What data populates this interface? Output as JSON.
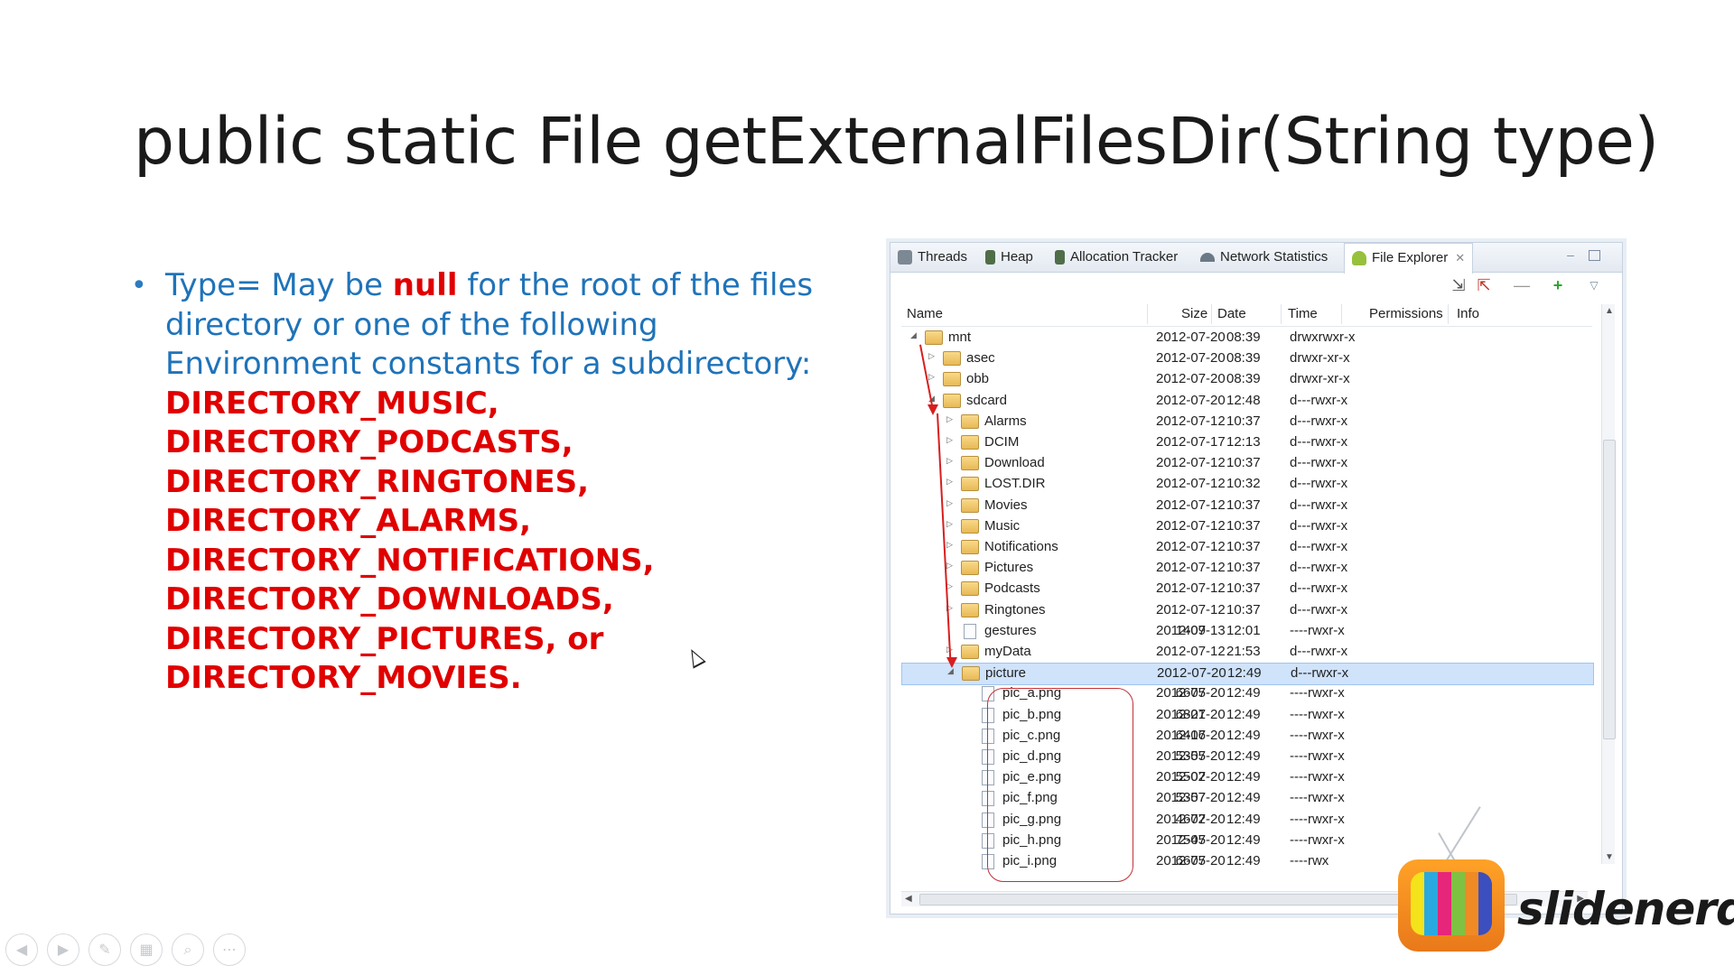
{
  "slide": {
    "title": "public static File getExternalFilesDir(String type)",
    "bullet_lead": "Type= May be ",
    "bullet_null": "null",
    "bullet_rest": " for the root of the files directory or one of the following Environment constants for a subdirectory:",
    "constants": [
      "DIRECTORY_MUSIC,",
      "DIRECTORY_PODCASTS,",
      "DIRECTORY_RINGTONES,",
      "DIRECTORY_ALARMS,",
      "DIRECTORY_NOTIFICATIONS,",
      "DIRECTORY_DOWNLOADS,",
      "DIRECTORY_PICTURES, or",
      "DIRECTORY_MOVIES."
    ],
    "accent_blue": "#1f73b9",
    "accent_red": "#e00000"
  },
  "ddms": {
    "tabs": [
      {
        "label": "Threads",
        "icon": "threads-icon"
      },
      {
        "label": "Heap",
        "icon": "heap-icon"
      },
      {
        "label": "Allocation Tracker",
        "icon": "allocation-tracker-icon"
      },
      {
        "label": "Network Statistics",
        "icon": "network-statistics-icon"
      },
      {
        "label": "File Explorer",
        "icon": "android-icon"
      }
    ],
    "toolbar": [
      "pull-file-icon",
      "push-file-icon",
      "delete-icon",
      "new-folder-icon",
      "view-menu-icon"
    ],
    "columns": {
      "name": "Name",
      "size": "Size",
      "date": "Date",
      "time": "Time",
      "permissions": "Permissions",
      "info": "Info"
    },
    "rows": [
      {
        "name": "mnt",
        "size": "",
        "date": "2012-07-20",
        "time": "08:39",
        "perm": "drwxrwxr-x"
      },
      {
        "name": "asec",
        "size": "",
        "date": "2012-07-20",
        "time": "08:39",
        "perm": "drwxr-xr-x"
      },
      {
        "name": "obb",
        "size": "",
        "date": "2012-07-20",
        "time": "08:39",
        "perm": "drwxr-xr-x"
      },
      {
        "name": "sdcard",
        "size": "",
        "date": "2012-07-20",
        "time": "12:48",
        "perm": "d---rwxr-x"
      },
      {
        "name": "Alarms",
        "size": "",
        "date": "2012-07-12",
        "time": "10:37",
        "perm": "d---rwxr-x"
      },
      {
        "name": "DCIM",
        "size": "",
        "date": "2012-07-17",
        "time": "12:13",
        "perm": "d---rwxr-x"
      },
      {
        "name": "Download",
        "size": "",
        "date": "2012-07-12",
        "time": "10:37",
        "perm": "d---rwxr-x"
      },
      {
        "name": "LOST.DIR",
        "size": "",
        "date": "2012-07-12",
        "time": "10:32",
        "perm": "d---rwxr-x"
      },
      {
        "name": "Movies",
        "size": "",
        "date": "2012-07-12",
        "time": "10:37",
        "perm": "d---rwxr-x"
      },
      {
        "name": "Music",
        "size": "",
        "date": "2012-07-12",
        "time": "10:37",
        "perm": "d---rwxr-x"
      },
      {
        "name": "Notifications",
        "size": "",
        "date": "2012-07-12",
        "time": "10:37",
        "perm": "d---rwxr-x"
      },
      {
        "name": "Pictures",
        "size": "",
        "date": "2012-07-12",
        "time": "10:37",
        "perm": "d---rwxr-x"
      },
      {
        "name": "Podcasts",
        "size": "",
        "date": "2012-07-12",
        "time": "10:37",
        "perm": "d---rwxr-x"
      },
      {
        "name": "Ringtones",
        "size": "",
        "date": "2012-07-12",
        "time": "10:37",
        "perm": "d---rwxr-x"
      },
      {
        "name": "gestures",
        "size": "1409",
        "date": "2012-07-13",
        "time": "12:01",
        "perm": "----rwxr-x"
      },
      {
        "name": "myData",
        "size": "",
        "date": "2012-07-12",
        "time": "21:53",
        "perm": "d---rwxr-x"
      },
      {
        "name": "picture",
        "size": "",
        "date": "2012-07-20",
        "time": "12:49",
        "perm": "d---rwxr-x"
      },
      {
        "name": "pic_a.png",
        "size": "6675",
        "date": "2012-07-20",
        "time": "12:49",
        "perm": "----rwxr-x"
      },
      {
        "name": "pic_b.png",
        "size": "6821",
        "date": "2012-07-20",
        "time": "12:49",
        "perm": "----rwxr-x"
      },
      {
        "name": "pic_c.png",
        "size": "6416",
        "date": "2012-07-20",
        "time": "12:49",
        "perm": "----rwxr-x"
      },
      {
        "name": "pic_d.png",
        "size": "5355",
        "date": "2012-07-20",
        "time": "12:49",
        "perm": "----rwxr-x"
      },
      {
        "name": "pic_e.png",
        "size": "5502",
        "date": "2012-07-20",
        "time": "12:49",
        "perm": "----rwxr-x"
      },
      {
        "name": "pic_f.png",
        "size": "5357",
        "date": "2012-07-20",
        "time": "12:49",
        "perm": "----rwxr-x"
      },
      {
        "name": "pic_g.png",
        "size": "4672",
        "date": "2012-07-20",
        "time": "12:49",
        "perm": "----rwxr-x"
      },
      {
        "name": "pic_h.png",
        "size": "7545",
        "date": "2012-07-20",
        "time": "12:49",
        "perm": "----rwxr-x"
      },
      {
        "name": "pic_i.png",
        "size": "6675",
        "date": "2012-07-20",
        "time": "12:49",
        "perm": "----rwx"
      }
    ],
    "selected_row": "picture"
  },
  "logo": {
    "text": "slidenerd",
    "tv_colors": [
      "#f4e21b",
      "#29a9df",
      "#e6267a",
      "#7fc242",
      "#f08a24",
      "#3b4fbf"
    ]
  },
  "nav": [
    "back-icon",
    "forward-icon",
    "pen-icon",
    "slides-icon",
    "zoom-icon",
    "more-icon"
  ]
}
